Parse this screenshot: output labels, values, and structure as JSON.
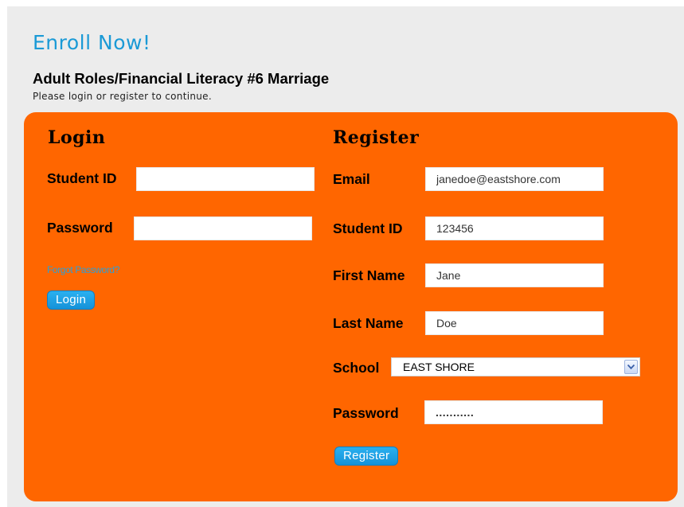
{
  "header": {
    "title": "Enroll Now!",
    "course_title": "Adult Roles/Financial Literacy #6 Marriage",
    "subtitle": "Please login or register to continue."
  },
  "login": {
    "heading": "Login",
    "student_id_label": "Student ID",
    "student_id_value": "",
    "password_label": "Password",
    "password_value": "",
    "forgot_password": "Forgot Password?",
    "button_label": "Login"
  },
  "register": {
    "heading": "Register",
    "email_label": "Email",
    "email_value": "janedoe@eastshore.com",
    "student_id_label": "Student ID",
    "student_id_value": "123456",
    "first_name_label": "First Name",
    "first_name_value": "Jane",
    "last_name_label": "Last Name",
    "last_name_value": "Doe",
    "school_label": "School",
    "school_value": "EAST SHORE",
    "password_label": "Password",
    "password_value": "...........",
    "button_label": "Register"
  },
  "colors": {
    "accent": "#1b9ad6",
    "panel": "#ff6600",
    "background": "#ececec",
    "button": "#1692d8"
  },
  "icons": {
    "select_arrow": "chevron-down-icon"
  }
}
